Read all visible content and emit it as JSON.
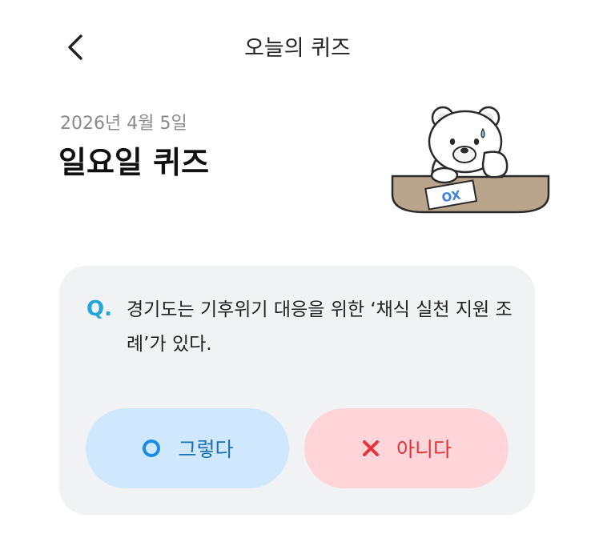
{
  "header": {
    "title": "오늘의 퀴즈",
    "back_icon": "chevron-left-icon"
  },
  "quiz": {
    "date": "2026년 4월 5일",
    "title": "일요일 퀴즈",
    "mascot": "bear-mascot-illustration",
    "mascot_paper_text": "OX"
  },
  "question": {
    "prefix": "Q.",
    "text": "경기도는 기후위기 대응을 위한 ‘채식 실천 지원 조례’가 있다."
  },
  "answers": {
    "yes": {
      "label": "그렇다",
      "icon": "circle-o-icon",
      "color": "#1a8be6"
    },
    "no": {
      "label": "아니다",
      "icon": "x-mark-icon",
      "color": "#e8333a"
    }
  },
  "colors": {
    "accent_q": "#22a7d9",
    "card_bg": "#f1f2f4",
    "yes_bg": "#cfe8fd",
    "no_bg": "#ffd5d9"
  }
}
